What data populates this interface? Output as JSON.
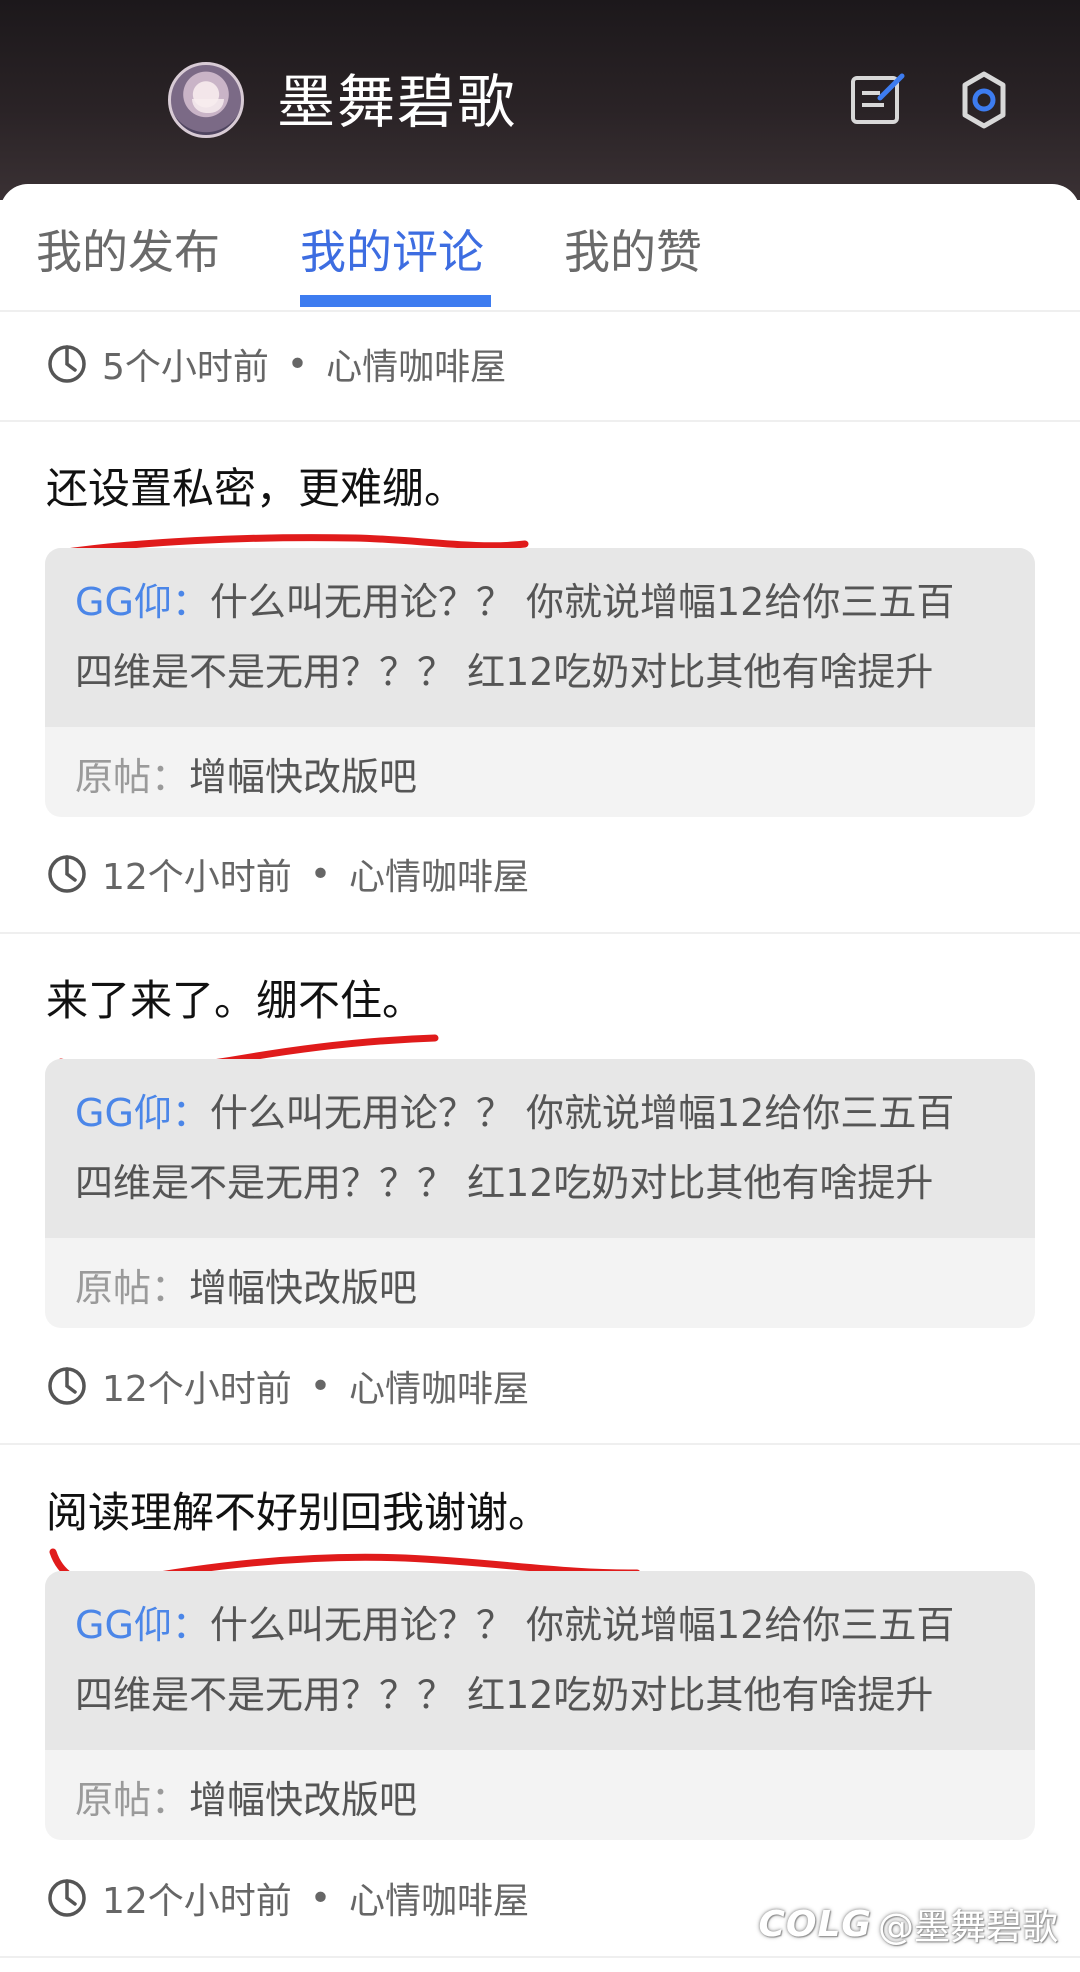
{
  "header": {
    "title": "墨舞碧歌",
    "icons": {
      "avatar": "user-avatar",
      "edit": "edit-icon",
      "settings": "gear-icon"
    }
  },
  "tabs": [
    {
      "label": "我的发布",
      "active": false
    },
    {
      "label": "我的评论",
      "active": true
    },
    {
      "label": "我的赞",
      "active": false
    }
  ],
  "top_meta": {
    "time": "5个小时前",
    "separator": "•",
    "board": "心情咖啡屋"
  },
  "comments": [
    {
      "text": "还设置私密，更难绷。",
      "quote_author": "GG仰：",
      "quote_text_line1": "什么叫无用论？？ 你就说增幅12给你三五百",
      "quote_text_line2": "四维是不是无用？？？ 红12吃奶对比其他有啥提升",
      "origin_label": "原帖：",
      "origin_title": "增幅快改版吧",
      "time": "12个小时前",
      "separator": "•",
      "board": "心情咖啡屋"
    },
    {
      "text": "来了来了。绷不住。",
      "quote_author": "GG仰：",
      "quote_text_line1": "什么叫无用论？？ 你就说增幅12给你三五百",
      "quote_text_line2": "四维是不是无用？？？ 红12吃奶对比其他有啥提升",
      "origin_label": "原帖：",
      "origin_title": "增幅快改版吧",
      "time": "12个小时前",
      "separator": "•",
      "board": "心情咖啡屋"
    },
    {
      "text": "阅读理解不好别回我谢谢。",
      "quote_author": "GG仰：",
      "quote_text_line1": "什么叫无用论？？ 你就说增幅12给你三五百",
      "quote_text_line2": "四维是不是无用？？？ 红12吃奶对比其他有啥提升",
      "origin_label": "原帖：",
      "origin_title": "增幅快改版吧",
      "time": "12个小时前",
      "separator": "•",
      "board": "心情咖啡屋"
    }
  ],
  "watermark": {
    "logo": "COLG",
    "text": "@墨舞碧歌"
  },
  "colors": {
    "accent": "#3d7cf0",
    "author": "#4b86e8",
    "scribble": "#e01b1b"
  }
}
